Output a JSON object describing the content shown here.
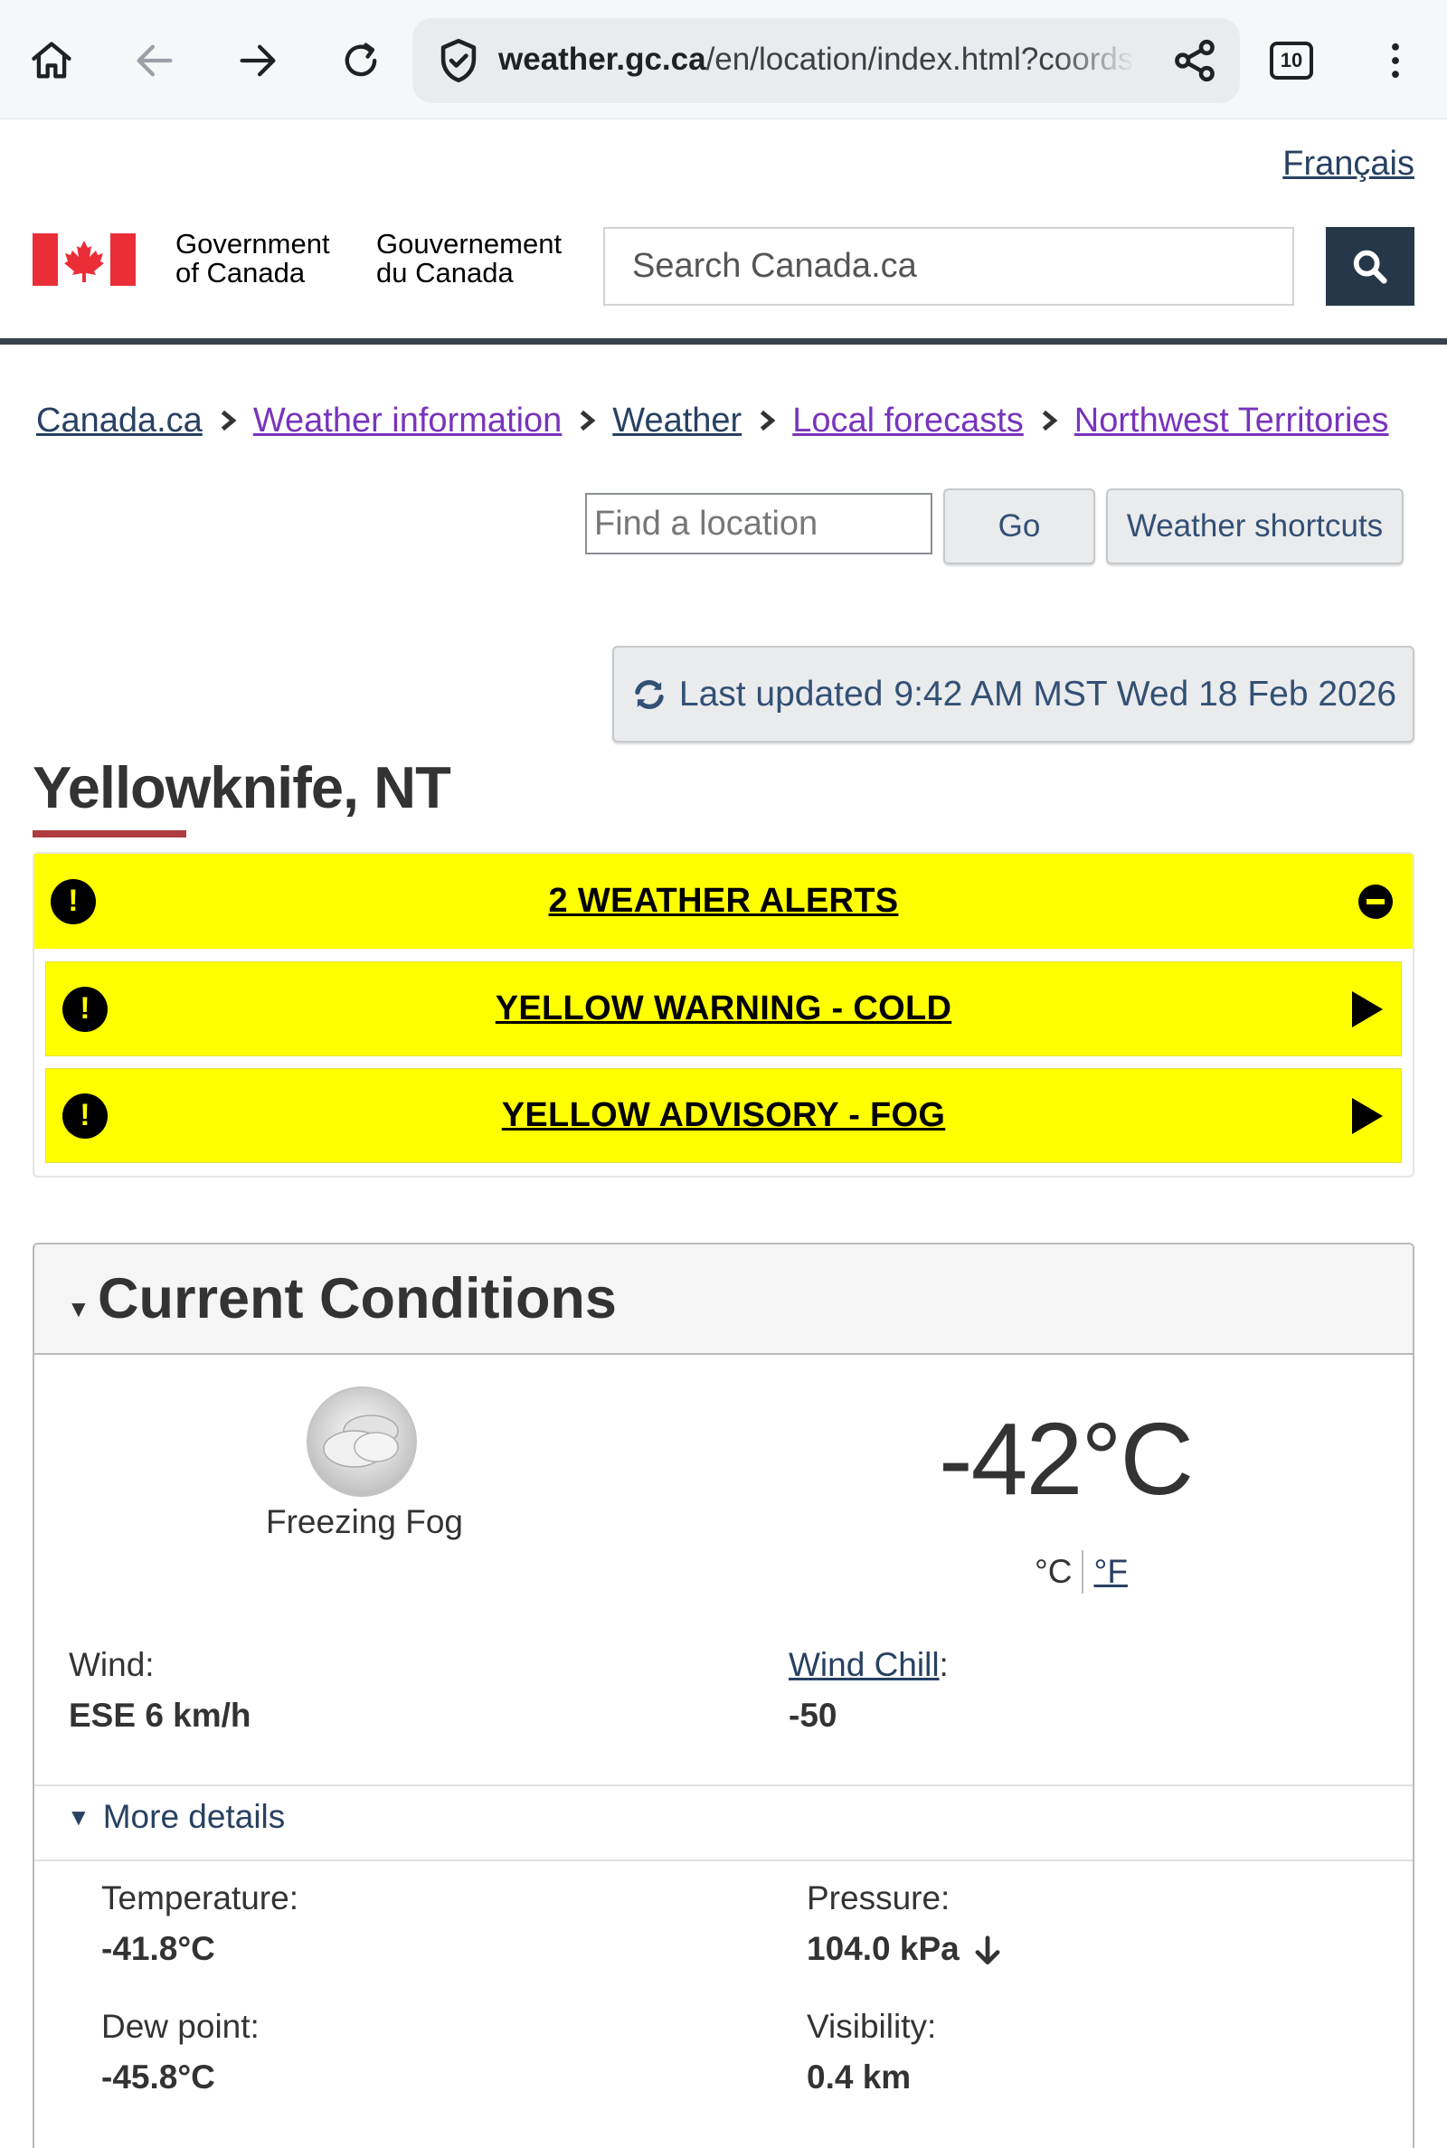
{
  "browser": {
    "url_host": "weather.gc.ca",
    "url_path": "/en/location/index.html?coords",
    "tab_count": "10"
  },
  "header": {
    "language_link": "Français",
    "gov_en_line1": "Government",
    "gov_en_line2": "of Canada",
    "gov_fr_line1": "Gouvernement",
    "gov_fr_line2": "du Canada",
    "search_placeholder": "Search Canada.ca"
  },
  "breadcrumb": [
    {
      "label": "Canada.ca"
    },
    {
      "label": "Weather information"
    },
    {
      "label": "Weather"
    },
    {
      "label": "Local forecasts"
    },
    {
      "label": "Northwest Territories"
    }
  ],
  "location_search": {
    "placeholder": "Find a location",
    "go_label": "Go",
    "shortcuts_label": "Weather shortcuts"
  },
  "last_updated": {
    "label": "Last updated",
    "time": "9:42 AM MST Wed 18 Feb 2026"
  },
  "page_title": "Yellowknife, NT",
  "alerts": {
    "summary": "2 WEATHER ALERTS",
    "items": [
      {
        "label": "YELLOW WARNING - COLD"
      },
      {
        "label": "YELLOW ADVISORY - FOG"
      }
    ],
    "color": "#ffff00"
  },
  "current_conditions": {
    "heading": "Current Conditions",
    "condition": "Freezing Fog",
    "icon": "freezing-fog-icon",
    "temperature": "-42°C",
    "unit_c": "°C",
    "unit_f": "°F",
    "wind_label": "Wind:",
    "wind_value": "ESE 6 km/h",
    "wind_chill_label": "Wind Chill",
    "wind_chill_value": "-50",
    "more_details": "More details",
    "details": {
      "temperature_label": "Temperature:",
      "temperature_value": "-41.8°C",
      "pressure_label": "Pressure:",
      "pressure_value": "104.0 kPa",
      "pressure_trend": "falling",
      "dew_point_label": "Dew point:",
      "dew_point_value": "-45.8°C",
      "visibility_label": "Visibility:",
      "visibility_value": "0.4 km"
    }
  },
  "colors": {
    "gc_dark": "#26374a",
    "link": "#284162",
    "visited_link": "#7834bc",
    "title_accent": "#af3c43"
  }
}
